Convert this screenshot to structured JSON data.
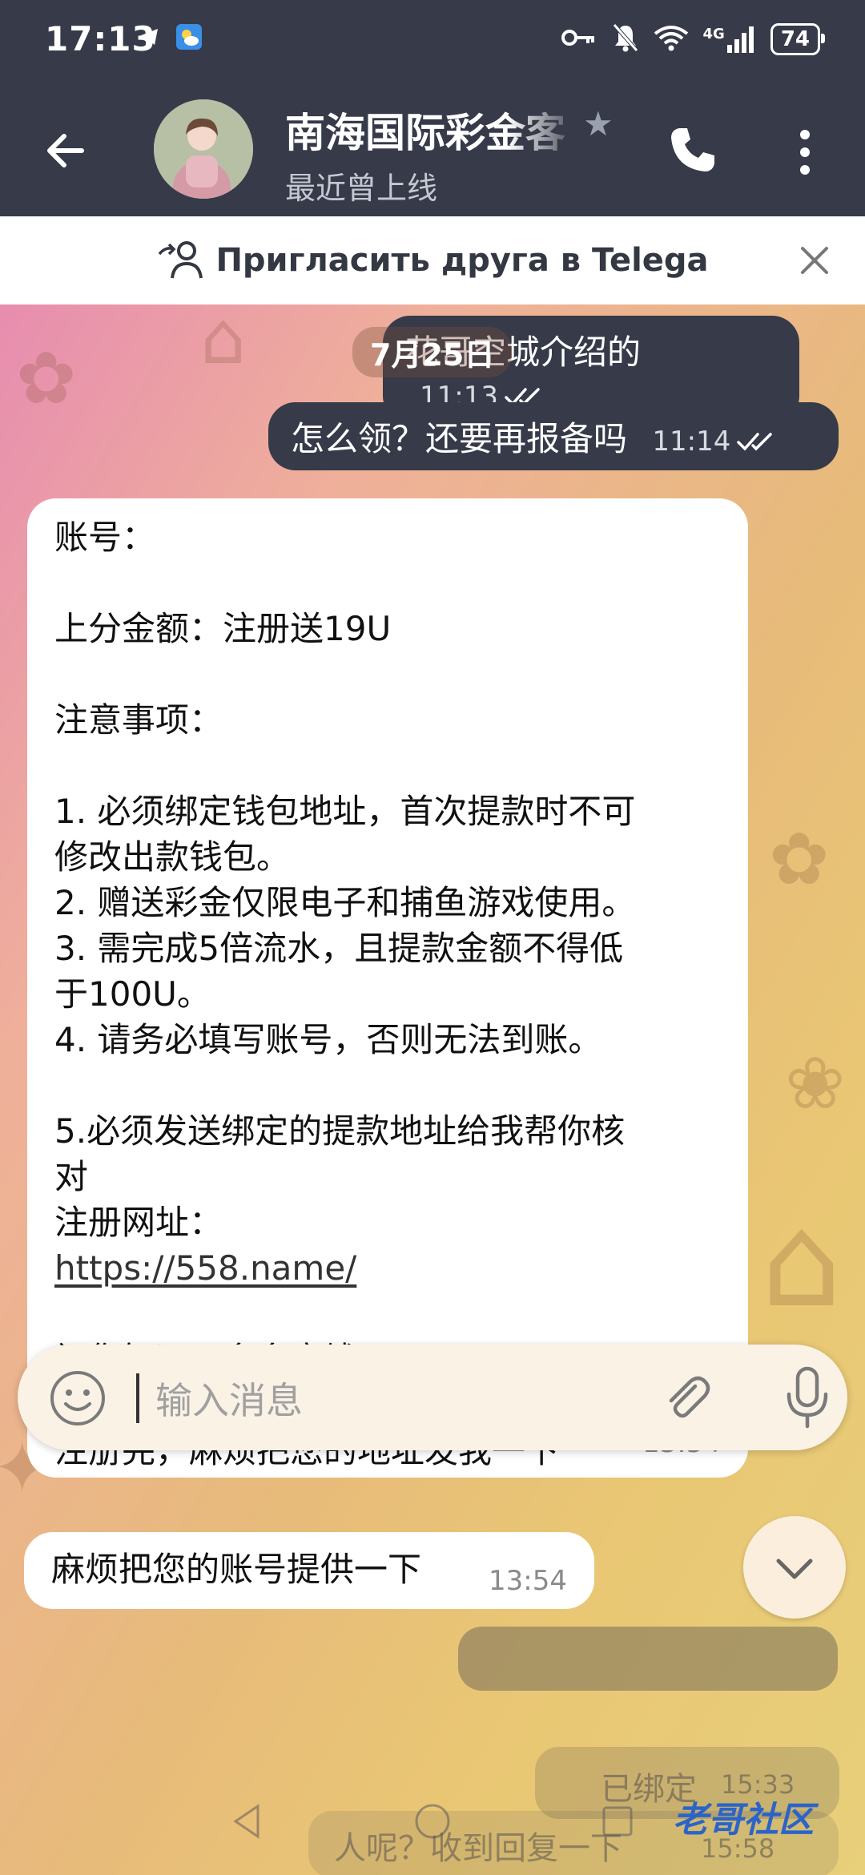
{
  "status_bar": {
    "time": "17:13",
    "network": "4G",
    "battery": "74"
  },
  "header": {
    "title": "南海国际彩金客",
    "subtitle": "最近曾上线"
  },
  "invite_banner": {
    "text": "Пригласить друга в Telega"
  },
  "chat": {
    "date_label": "7月25日",
    "outgoing": [
      {
        "text": "花哥空城介绍的",
        "time": "11:13"
      },
      {
        "text": "怎么领？还要再报备吗",
        "time": "11:14"
      }
    ],
    "incoming_main": {
      "lines": [
        "账号：",
        "",
        "上分金额：注册送19U",
        "",
        "注意事项：",
        "",
        "1. 必须绑定钱包地址，首次提款时不可",
        "修改出款钱包。",
        "2. 赠送彩金仅限电子和捕鱼游戏使用。",
        "3. 需完成5倍流水，且提款金额不得低",
        "于100U。",
        "4. 请务必填写账号，否则无法到账。",
        "",
        "5.必须发送绑定的提款地址给我帮你核",
        "对",
        "注册网址：",
        "https://558.name/",
        "",
        "祝您好运，多多赢钱！",
        "",
        "注册完，麻烦把您的地址发我一下"
      ],
      "time": "13:54"
    },
    "incoming_short": {
      "text": "麻烦把您的账号提供一下",
      "time": "13:54"
    },
    "below_composer": [
      {
        "text": "已绑定",
        "time": "15:33"
      },
      {
        "text": "人呢？收到回复一下",
        "time": "15:58"
      }
    ]
  },
  "composer": {
    "placeholder": "输入消息"
  },
  "watermark": "老哥社区"
}
